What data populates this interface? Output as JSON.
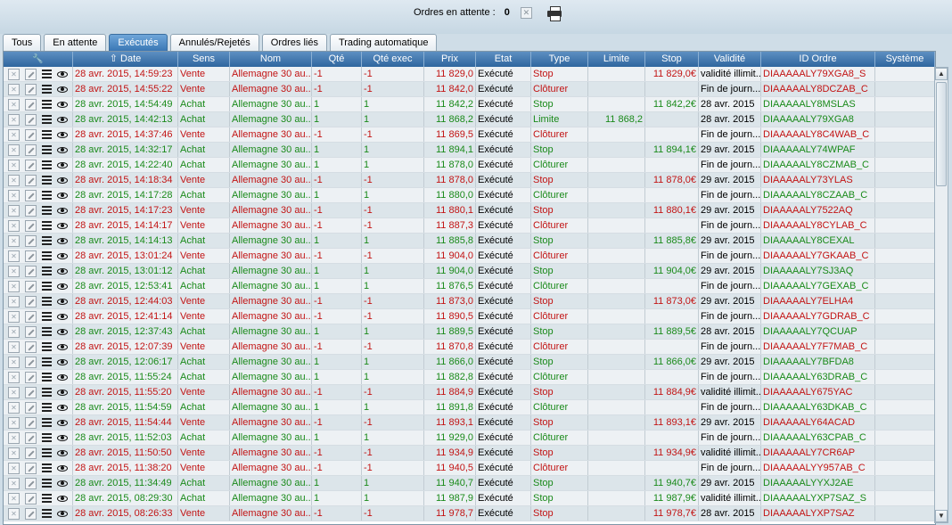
{
  "toolbar": {
    "pending_label": "Ordres en attente :",
    "pending_count": "0",
    "close_icon": "close-small-icon",
    "print_icon": "printer-icon"
  },
  "tabs": [
    "Tous",
    "En attente",
    "Exécutés",
    "Annulés/Rejetés",
    "Ordres liés",
    "Trading automatique"
  ],
  "active_tab": "Exécutés",
  "colors": {
    "sell": "#c21414",
    "buy": "#1a8a1a",
    "header": "#3a77b5"
  },
  "columns": [
    "",
    "Date",
    "Sens",
    "Nom",
    "Qté",
    "Qté exec",
    "Prix",
    "Etat",
    "Type",
    "Limite",
    "Stop",
    "Validité",
    "ID Ordre",
    "Système"
  ],
  "sort_icon": "sort-up-arrow-icon",
  "rows": [
    {
      "date": "28 avr. 2015, 14:59:23",
      "sens": "Vente",
      "nom": "Allemagne 30 au...",
      "qte": "-1",
      "qte_exec": "-1",
      "prix": "11 829,0",
      "etat": "Exécuté",
      "type": "Stop",
      "limite": "",
      "stop": "11 829,0€",
      "validite": "validité illimit...",
      "id": "DIAAAAALY79XGA8_S",
      "systeme": ""
    },
    {
      "date": "28 avr. 2015, 14:55:22",
      "sens": "Vente",
      "nom": "Allemagne 30 au...",
      "qte": "-1",
      "qte_exec": "-1",
      "prix": "11 842,0",
      "etat": "Exécuté",
      "type": "Clôturer",
      "limite": "",
      "stop": "",
      "validite": "Fin de journ...",
      "id": "DIAAAAALY8DCZAB_C",
      "systeme": ""
    },
    {
      "date": "28 avr. 2015, 14:54:49",
      "sens": "Achat",
      "nom": "Allemagne 30 au...",
      "qte": "1",
      "qte_exec": "1",
      "prix": "11 842,2",
      "etat": "Exécuté",
      "type": "Stop",
      "limite": "",
      "stop": "11 842,2€",
      "validite": "28 avr. 2015",
      "id": "DIAAAAALY8MSLAS",
      "systeme": ""
    },
    {
      "date": "28 avr. 2015, 14:42:13",
      "sens": "Achat",
      "nom": "Allemagne 30 au...",
      "qte": "1",
      "qte_exec": "1",
      "prix": "11 868,2",
      "etat": "Exécuté",
      "type": "Limite",
      "limite": "11 868,2",
      "stop": "",
      "validite": "28 avr. 2015",
      "id": "DIAAAAALY79XGA8",
      "systeme": ""
    },
    {
      "date": "28 avr. 2015, 14:37:46",
      "sens": "Vente",
      "nom": "Allemagne 30 au...",
      "qte": "-1",
      "qte_exec": "-1",
      "prix": "11 869,5",
      "etat": "Exécuté",
      "type": "Clôturer",
      "limite": "",
      "stop": "",
      "validite": "Fin de journ...",
      "id": "DIAAAAALY8C4WAB_C",
      "systeme": ""
    },
    {
      "date": "28 avr. 2015, 14:32:17",
      "sens": "Achat",
      "nom": "Allemagne 30 au...",
      "qte": "1",
      "qte_exec": "1",
      "prix": "11 894,1",
      "etat": "Exécuté",
      "type": "Stop",
      "limite": "",
      "stop": "11 894,1€",
      "validite": "29 avr. 2015",
      "id": "DIAAAAALY74WPAF",
      "systeme": ""
    },
    {
      "date": "28 avr. 2015, 14:22:40",
      "sens": "Achat",
      "nom": "Allemagne 30 au...",
      "qte": "1",
      "qte_exec": "1",
      "prix": "11 878,0",
      "etat": "Exécuté",
      "type": "Clôturer",
      "limite": "",
      "stop": "",
      "validite": "Fin de journ...",
      "id": "DIAAAAALY8CZMAB_C",
      "systeme": ""
    },
    {
      "date": "28 avr. 2015, 14:18:34",
      "sens": "Vente",
      "nom": "Allemagne 30 au...",
      "qte": "-1",
      "qte_exec": "-1",
      "prix": "11 878,0",
      "etat": "Exécuté",
      "type": "Stop",
      "limite": "",
      "stop": "11 878,0€",
      "validite": "29 avr. 2015",
      "id": "DIAAAAALY73YLAS",
      "systeme": ""
    },
    {
      "date": "28 avr. 2015, 14:17:28",
      "sens": "Achat",
      "nom": "Allemagne 30 au...",
      "qte": "1",
      "qte_exec": "1",
      "prix": "11 880,0",
      "etat": "Exécuté",
      "type": "Clôturer",
      "limite": "",
      "stop": "",
      "validite": "Fin de journ...",
      "id": "DIAAAAALY8CZAAB_C",
      "systeme": ""
    },
    {
      "date": "28 avr. 2015, 14:17:23",
      "sens": "Vente",
      "nom": "Allemagne 30 au...",
      "qte": "-1",
      "qte_exec": "-1",
      "prix": "11 880,1",
      "etat": "Exécuté",
      "type": "Stop",
      "limite": "",
      "stop": "11 880,1€",
      "validite": "29 avr. 2015",
      "id": "DIAAAAALY7522AQ",
      "systeme": ""
    },
    {
      "date": "28 avr. 2015, 14:14:17",
      "sens": "Vente",
      "nom": "Allemagne 30 au...",
      "qte": "-1",
      "qte_exec": "-1",
      "prix": "11 887,3",
      "etat": "Exécuté",
      "type": "Clôturer",
      "limite": "",
      "stop": "",
      "validite": "Fin de journ...",
      "id": "DIAAAAALY8CYLAB_C",
      "systeme": ""
    },
    {
      "date": "28 avr. 2015, 14:14:13",
      "sens": "Achat",
      "nom": "Allemagne 30 au...",
      "qte": "1",
      "qte_exec": "1",
      "prix": "11 885,8",
      "etat": "Exécuté",
      "type": "Stop",
      "limite": "",
      "stop": "11 885,8€",
      "validite": "29 avr. 2015",
      "id": "DIAAAAALY8CEXAL",
      "systeme": ""
    },
    {
      "date": "28 avr. 2015, 13:01:24",
      "sens": "Vente",
      "nom": "Allemagne 30 au...",
      "qte": "-1",
      "qte_exec": "-1",
      "prix": "11 904,0",
      "etat": "Exécuté",
      "type": "Clôturer",
      "limite": "",
      "stop": "",
      "validite": "Fin de journ...",
      "id": "DIAAAAALY7GKAAB_C",
      "systeme": ""
    },
    {
      "date": "28 avr. 2015, 13:01:12",
      "sens": "Achat",
      "nom": "Allemagne 30 au...",
      "qte": "1",
      "qte_exec": "1",
      "prix": "11 904,0",
      "etat": "Exécuté",
      "type": "Stop",
      "limite": "",
      "stop": "11 904,0€",
      "validite": "29 avr. 2015",
      "id": "DIAAAAALY7SJ3AQ",
      "systeme": ""
    },
    {
      "date": "28 avr. 2015, 12:53:41",
      "sens": "Achat",
      "nom": "Allemagne 30 au...",
      "qte": "1",
      "qte_exec": "1",
      "prix": "11 876,5",
      "etat": "Exécuté",
      "type": "Clôturer",
      "limite": "",
      "stop": "",
      "validite": "Fin de journ...",
      "id": "DIAAAAALY7GEXAB_C",
      "systeme": ""
    },
    {
      "date": "28 avr. 2015, 12:44:03",
      "sens": "Vente",
      "nom": "Allemagne 30 au...",
      "qte": "-1",
      "qte_exec": "-1",
      "prix": "11 873,0",
      "etat": "Exécuté",
      "type": "Stop",
      "limite": "",
      "stop": "11 873,0€",
      "validite": "29 avr. 2015",
      "id": "DIAAAAALY7ELHA4",
      "systeme": ""
    },
    {
      "date": "28 avr. 2015, 12:41:14",
      "sens": "Vente",
      "nom": "Allemagne 30 au...",
      "qte": "-1",
      "qte_exec": "-1",
      "prix": "11 890,5",
      "etat": "Exécuté",
      "type": "Clôturer",
      "limite": "",
      "stop": "",
      "validite": "Fin de journ...",
      "id": "DIAAAAALY7GDRAB_C",
      "systeme": ""
    },
    {
      "date": "28 avr. 2015, 12:37:43",
      "sens": "Achat",
      "nom": "Allemagne 30 au...",
      "qte": "1",
      "qte_exec": "1",
      "prix": "11 889,5",
      "etat": "Exécuté",
      "type": "Stop",
      "limite": "",
      "stop": "11 889,5€",
      "validite": "28 avr. 2015",
      "id": "DIAAAAALY7QCUAP",
      "systeme": ""
    },
    {
      "date": "28 avr. 2015, 12:07:39",
      "sens": "Vente",
      "nom": "Allemagne 30 au...",
      "qte": "-1",
      "qte_exec": "-1",
      "prix": "11 870,8",
      "etat": "Exécuté",
      "type": "Clôturer",
      "limite": "",
      "stop": "",
      "validite": "Fin de journ...",
      "id": "DIAAAAALY7F7MAB_C",
      "systeme": ""
    },
    {
      "date": "28 avr. 2015, 12:06:17",
      "sens": "Achat",
      "nom": "Allemagne 30 au...",
      "qte": "1",
      "qte_exec": "1",
      "prix": "11 866,0",
      "etat": "Exécuté",
      "type": "Stop",
      "limite": "",
      "stop": "11 866,0€",
      "validite": "29 avr. 2015",
      "id": "DIAAAAALY7BFDA8",
      "systeme": ""
    },
    {
      "date": "28 avr. 2015, 11:55:24",
      "sens": "Achat",
      "nom": "Allemagne 30 au...",
      "qte": "1",
      "qte_exec": "1",
      "prix": "11 882,8",
      "etat": "Exécuté",
      "type": "Clôturer",
      "limite": "",
      "stop": "",
      "validite": "Fin de journ...",
      "id": "DIAAAAALY63DRAB_C",
      "systeme": ""
    },
    {
      "date": "28 avr. 2015, 11:55:20",
      "sens": "Vente",
      "nom": "Allemagne 30 au...",
      "qte": "-1",
      "qte_exec": "-1",
      "prix": "11 884,9",
      "etat": "Exécuté",
      "type": "Stop",
      "limite": "",
      "stop": "11 884,9€",
      "validite": "validité illimit...",
      "id": "DIAAAAALY675YAC",
      "systeme": ""
    },
    {
      "date": "28 avr. 2015, 11:54:59",
      "sens": "Achat",
      "nom": "Allemagne 30 au...",
      "qte": "1",
      "qte_exec": "1",
      "prix": "11 891,8",
      "etat": "Exécuté",
      "type": "Clôturer",
      "limite": "",
      "stop": "",
      "validite": "Fin de journ...",
      "id": "DIAAAAALY63DKAB_C",
      "systeme": ""
    },
    {
      "date": "28 avr. 2015, 11:54:44",
      "sens": "Vente",
      "nom": "Allemagne 30 au...",
      "qte": "-1",
      "qte_exec": "-1",
      "prix": "11 893,1",
      "etat": "Exécuté",
      "type": "Stop",
      "limite": "",
      "stop": "11 893,1€",
      "validite": "29 avr. 2015",
      "id": "DIAAAAALY64ACAD",
      "systeme": ""
    },
    {
      "date": "28 avr. 2015, 11:52:03",
      "sens": "Achat",
      "nom": "Allemagne 30 au...",
      "qte": "1",
      "qte_exec": "1",
      "prix": "11 929,0",
      "etat": "Exécuté",
      "type": "Clôturer",
      "limite": "",
      "stop": "",
      "validite": "Fin de journ...",
      "id": "DIAAAAALY63CPAB_C",
      "systeme": ""
    },
    {
      "date": "28 avr. 2015, 11:50:50",
      "sens": "Vente",
      "nom": "Allemagne 30 au...",
      "qte": "-1",
      "qte_exec": "-1",
      "prix": "11 934,9",
      "etat": "Exécuté",
      "type": "Stop",
      "limite": "",
      "stop": "11 934,9€",
      "validite": "validité illimit...",
      "id": "DIAAAAALY7CR6AP",
      "systeme": ""
    },
    {
      "date": "28 avr. 2015, 11:38:20",
      "sens": "Vente",
      "nom": "Allemagne 30 au...",
      "qte": "-1",
      "qte_exec": "-1",
      "prix": "11 940,5",
      "etat": "Exécuté",
      "type": "Clôturer",
      "limite": "",
      "stop": "",
      "validite": "Fin de journ...",
      "id": "DIAAAAALYY957AB_C",
      "systeme": ""
    },
    {
      "date": "28 avr. 2015, 11:34:49",
      "sens": "Achat",
      "nom": "Allemagne 30 au...",
      "qte": "1",
      "qte_exec": "1",
      "prix": "11 940,7",
      "etat": "Exécuté",
      "type": "Stop",
      "limite": "",
      "stop": "11 940,7€",
      "validite": "29 avr. 2015",
      "id": "DIAAAAALYYXJ2AE",
      "systeme": ""
    },
    {
      "date": "28 avr. 2015, 08:29:30",
      "sens": "Achat",
      "nom": "Allemagne 30 au...",
      "qte": "1",
      "qte_exec": "1",
      "prix": "11 987,9",
      "etat": "Exécuté",
      "type": "Stop",
      "limite": "",
      "stop": "11 987,9€",
      "validite": "validité illimit...",
      "id": "DIAAAAALYXP7SAZ_S",
      "systeme": ""
    },
    {
      "date": "28 avr. 2015, 08:26:33",
      "sens": "Vente",
      "nom": "Allemagne 30 au...",
      "qte": "-1",
      "qte_exec": "-1",
      "prix": "11 978,7",
      "etat": "Exécuté",
      "type": "Stop",
      "limite": "",
      "stop": "11 978,7€",
      "validite": "28 avr. 2015",
      "id": "DIAAAAALYXP7SAZ",
      "systeme": ""
    }
  ]
}
